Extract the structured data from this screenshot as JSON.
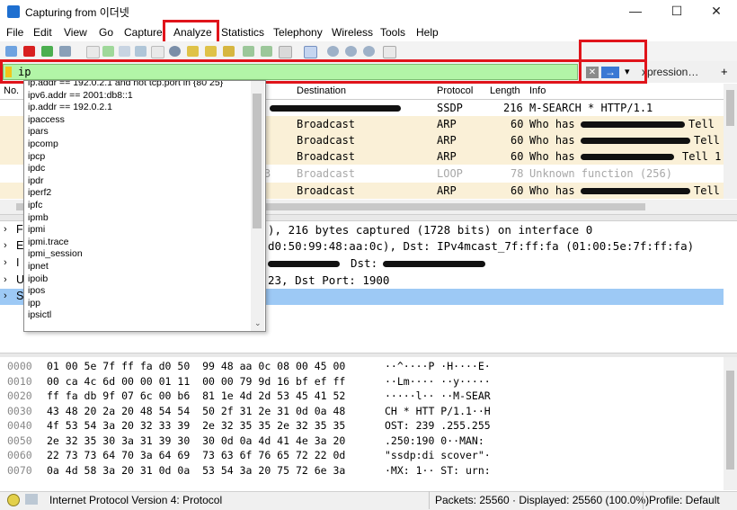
{
  "window": {
    "title": "Capturing from 이더넷",
    "minimize": "—",
    "maximize": "☐",
    "close": "✕"
  },
  "menu": [
    "File",
    "Edit",
    "View",
    "Go",
    "Capture",
    "Analyze",
    "Statistics",
    "Telephony",
    "Wireless",
    "Tools",
    "Help"
  ],
  "filter": {
    "value": "ip",
    "expression_label": "xpression…",
    "add_label": "+",
    "arrow": "→",
    "dropdown": "▾",
    "clear": "✕"
  },
  "packet_list": {
    "columns": [
      "No.",
      "Destination",
      "Protocol",
      "Length",
      "Info"
    ],
    "rows": [
      {
        "dest": "",
        "proto": "SSDP",
        "len": "216",
        "info": "M-SEARCH * HTTP/1.1",
        "style": "white"
      },
      {
        "dest": "Broadcast",
        "proto": "ARP",
        "len": "60",
        "info": "Who has",
        "tail": "Tell",
        "style": "arp"
      },
      {
        "dest": "Broadcast",
        "proto": "ARP",
        "len": "60",
        "info": "Who has",
        "tail": "Tell",
        "style": "arp"
      },
      {
        "dest": "Broadcast",
        "proto": "ARP",
        "len": "60",
        "info": "Who has",
        "tail": "Tell 1",
        "style": "arp"
      },
      {
        "no_tail": "3",
        "dest": "Broadcast",
        "proto": "LOOP",
        "len": "78",
        "info": "Unknown function (256)",
        "style": "grey"
      },
      {
        "dest": "Broadcast",
        "proto": "ARP",
        "len": "60",
        "info": "Who has",
        "tail": "Tell",
        "style": "arp"
      }
    ]
  },
  "autocomplete": [
    "ip.addr == 192.0.2.1 and not tcp.port in {80 25}",
    "ipv6.addr == 2001:db8::1",
    "ip.addr == 192.0.2.1",
    "ipaccess",
    "ipars",
    "ipcomp",
    "ipcp",
    "ipdc",
    "ipdr",
    "iperf2",
    "ipfc",
    "ipmb",
    "ipmi",
    "ipmi.trace",
    "ipmi_session",
    "ipnet",
    "ipoib",
    "ipos",
    "ipp",
    "ipsictl"
  ],
  "details": [
    {
      "prefix": "F",
      "text": "), 216 bytes captured (1728 bits) on interface 0"
    },
    {
      "prefix": "E",
      "text": "d0:50:99:48:aa:0c), Dst: IPv4mcast_7f:ff:fa (01:00:5e:7f:ff:fa)"
    },
    {
      "prefix": "I",
      "text": "Dst:"
    },
    {
      "prefix": "U",
      "text": "23, Dst Port: 1900"
    },
    {
      "prefix": "S",
      "text": ""
    }
  ],
  "bytes": [
    {
      "off": "0000",
      "hex": "01 00 5e 7f ff fa d0 50  99 48 aa 0c 08 00 45 00",
      "ascii": "··^····P ·H····E·"
    },
    {
      "off": "0010",
      "hex": "00 ca 4c 6d 00 00 01 11  00 00 79 9d 16 bf ef ff",
      "ascii": "··Lm···· ··y·····"
    },
    {
      "off": "0020",
      "hex": "ff fa db 9f 07 6c 00 b6  81 1e 4d 2d 53 45 41 52",
      "ascii": "·····l·· ··M-SEAR"
    },
    {
      "off": "0030",
      "hex": "43 48 20 2a 20 48 54 54  50 2f 31 2e 31 0d 0a 48",
      "ascii": "CH * HTT P/1.1··H"
    },
    {
      "off": "0040",
      "hex": "4f 53 54 3a 20 32 33 39  2e 32 35 35 2e 32 35 35",
      "ascii": "OST: 239 .255.255"
    },
    {
      "off": "0050",
      "hex": "2e 32 35 30 3a 31 39 30  30 0d 0a 4d 41 4e 3a 20",
      "ascii": ".250:190 0··MAN: "
    },
    {
      "off": "0060",
      "hex": "22 73 73 64 70 3a 64 69  73 63 6f 76 65 72 22 0d",
      "ascii": "\"ssdp:di scover\"·"
    },
    {
      "off": "0070",
      "hex": "0a 4d 58 3a 20 31 0d 0a  53 54 3a 20 75 72 6e 3a",
      "ascii": "·MX: 1·· ST: urn:"
    }
  ],
  "status": {
    "left": "Internet Protocol Version 4: Protocol",
    "packets": "Packets: 25560 · Displayed: 25560 (100.0%)",
    "profile": "Profile: Default"
  },
  "colors": {
    "arp_row": "#faf0d7",
    "selected": "#9dc9f5",
    "filter_valid": "#b2f5a7",
    "annotation": "#e0141b"
  }
}
